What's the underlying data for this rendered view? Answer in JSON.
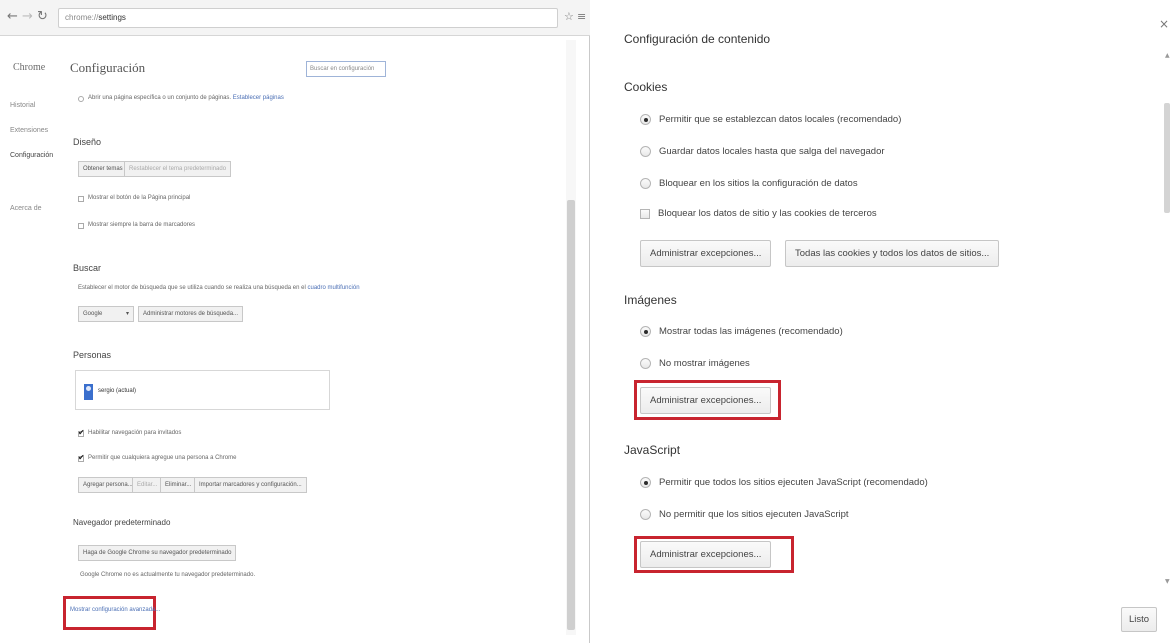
{
  "browser": {
    "url_prefix": "chrome://",
    "url_page": "settings",
    "sidebar": {
      "title": "Chrome",
      "items": [
        "Historial",
        "Extensiones",
        "Configuración",
        "Acerca de"
      ]
    },
    "page_title": "Configuración",
    "search_placeholder": "Buscar en configuración",
    "startup_text": "Abrir una página específica o un conjunto de páginas.",
    "startup_link": "Establecer páginas",
    "appearance": {
      "heading": "Diseño",
      "theme_button": "Obtener temas",
      "reset_theme_button": "Restablecer el tema predeterminado",
      "show_home": "Mostrar el botón de la Página principal",
      "show_bookmarks": "Mostrar siempre la barra de marcadores"
    },
    "search": {
      "heading": "Buscar",
      "description": "Establecer el motor de búsqueda que se utiliza cuando se realiza una búsqueda en el",
      "description_link": "cuadro multifunción",
      "engine": "Google",
      "manage_button": "Administrar motores de búsqueda..."
    },
    "people": {
      "heading": "Personas",
      "profile_name": "sergio (actual)",
      "guest_browsing": "Habilitar navegación para invitados",
      "allow_add": "Permitir que cualquiera agregue una persona a Chrome",
      "buttons": [
        "Agregar persona...",
        "Editar...",
        "Eliminar...",
        "Importar marcadores y configuración..."
      ]
    },
    "default_browser": {
      "heading": "Navegador predeterminado",
      "button": "Haga de Google Chrome su navegador predeterminado",
      "status": "Google Chrome no es actualmente tu navegador predeterminado."
    },
    "advanced_link": "Mostrar configuración avanzada..."
  },
  "dialog": {
    "title": "Configuración de contenido",
    "cookies": {
      "heading": "Cookies",
      "options": [
        "Permitir que se establezcan datos locales (recomendado)",
        "Guardar datos locales hasta que salga del navegador",
        "Bloquear en los sitios la configuración de datos",
        "Bloquear los datos de sitio y las cookies de terceros"
      ],
      "manage_button": "Administrar excepciones...",
      "all_cookies_button": "Todas las cookies y todos los datos de sitios..."
    },
    "images": {
      "heading": "Imágenes",
      "options": [
        "Mostrar todas las imágenes (recomendado)",
        "No mostrar imágenes"
      ],
      "manage_button": "Administrar excepciones..."
    },
    "javascript": {
      "heading": "JavaScript",
      "options": [
        "Permitir que todos los sitios ejecuten JavaScript (recomendado)",
        "No permitir que los sitios ejecuten JavaScript"
      ],
      "manage_button": "Administrar excepciones..."
    },
    "done_button": "Listo"
  },
  "colors": {
    "highlight": "#c8242f",
    "link": "#4b6fb5",
    "avatar": "#3a6fcd"
  }
}
